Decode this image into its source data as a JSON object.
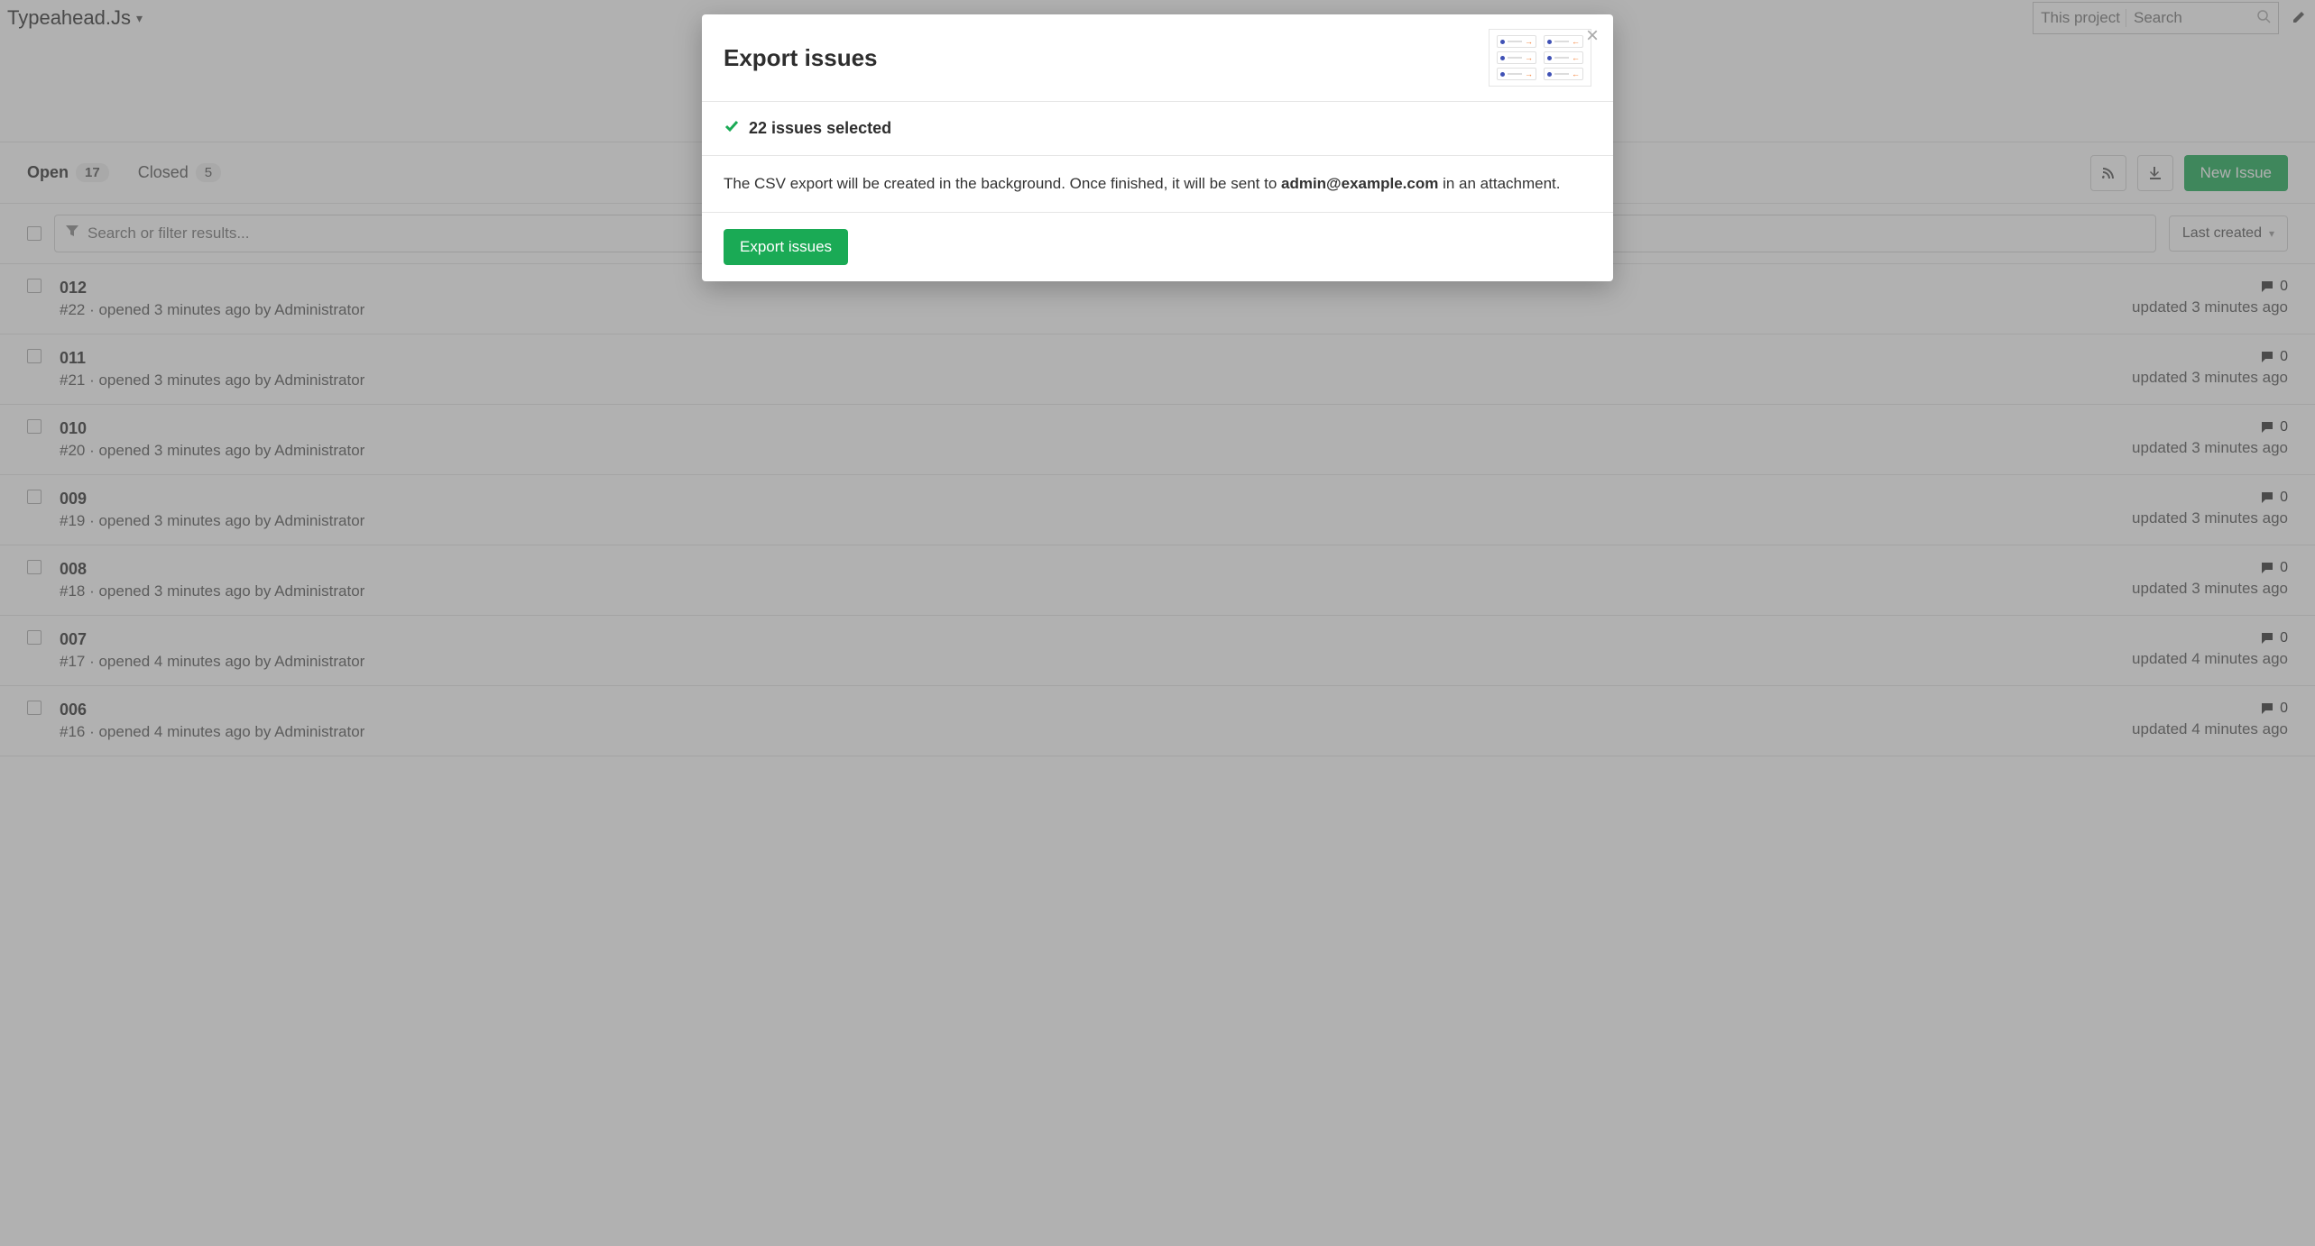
{
  "topbar": {
    "project_name": "Typeahead.Js",
    "search_scope": "This project",
    "search_placeholder": "Search"
  },
  "tabs": {
    "open_label": "Open",
    "open_count": "17",
    "closed_label": "Closed",
    "closed_count": "5",
    "new_issue_label": "New Issue"
  },
  "filter": {
    "placeholder": "Search or filter results...",
    "sort_label": "Last created"
  },
  "issues": [
    {
      "title": "012",
      "meta": "#22 · opened 3 minutes ago by Administrator",
      "comments": "0",
      "updated": "updated 3 minutes ago"
    },
    {
      "title": "011",
      "meta": "#21 · opened 3 minutes ago by Administrator",
      "comments": "0",
      "updated": "updated 3 minutes ago"
    },
    {
      "title": "010",
      "meta": "#20 · opened 3 minutes ago by Administrator",
      "comments": "0",
      "updated": "updated 3 minutes ago"
    },
    {
      "title": "009",
      "meta": "#19 · opened 3 minutes ago by Administrator",
      "comments": "0",
      "updated": "updated 3 minutes ago"
    },
    {
      "title": "008",
      "meta": "#18 · opened 3 minutes ago by Administrator",
      "comments": "0",
      "updated": "updated 3 minutes ago"
    },
    {
      "title": "007",
      "meta": "#17 · opened 4 minutes ago by Administrator",
      "comments": "0",
      "updated": "updated 4 minutes ago"
    },
    {
      "title": "006",
      "meta": "#16 · opened 4 minutes ago by Administrator",
      "comments": "0",
      "updated": "updated 4 minutes ago"
    }
  ],
  "modal": {
    "title": "Export issues",
    "selected_text": "22 issues selected",
    "body_prefix": "The CSV export will be created in the background. Once finished, it will be sent to ",
    "body_email": "admin@example.com",
    "body_suffix": " in an attachment.",
    "export_button": "Export issues"
  }
}
